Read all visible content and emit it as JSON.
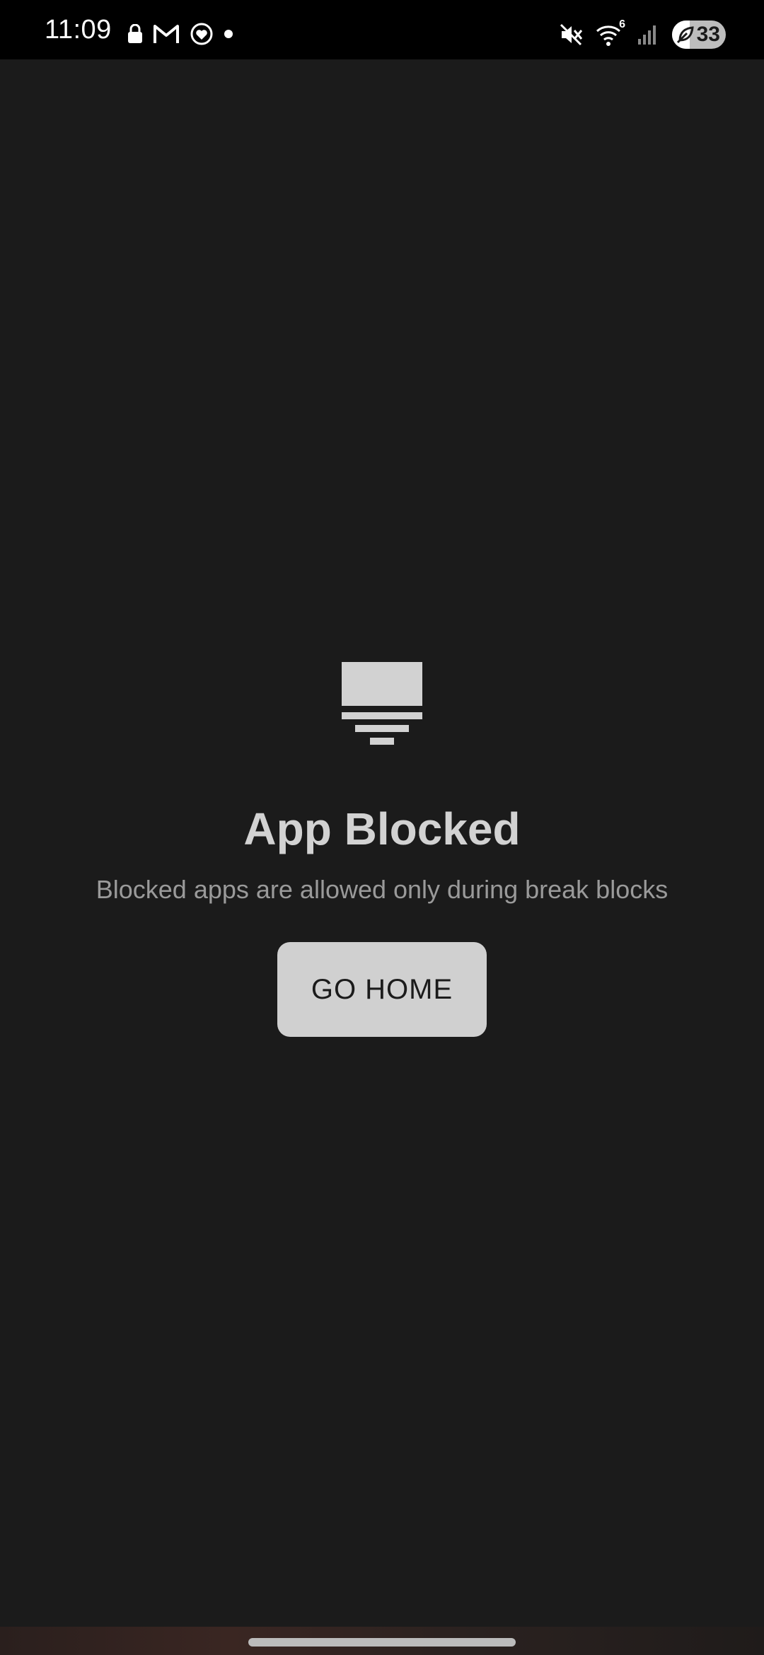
{
  "status_bar": {
    "time": "11:09",
    "battery_level": "33",
    "left_icons": [
      "lock-icon",
      "gmail-icon",
      "heart-circle-icon",
      "notification-dot-icon"
    ],
    "right_icons": [
      "vibrate-mute-icon",
      "wifi-6-icon",
      "cell-signal-icon",
      "battery-saver-icon"
    ],
    "wifi_badge": "6"
  },
  "main": {
    "icon": "block-screen-icon",
    "title": "App Blocked",
    "subtitle": "Blocked apps are allowed only during break blocks",
    "button_label": "GO HOME"
  },
  "colors": {
    "background": "#1b1b1b",
    "status_bar": "#000000",
    "title": "#d2d2d2",
    "subtitle": "#9a9a9a",
    "button_bg": "#d0d0d0",
    "button_text": "#1b1b1b"
  }
}
